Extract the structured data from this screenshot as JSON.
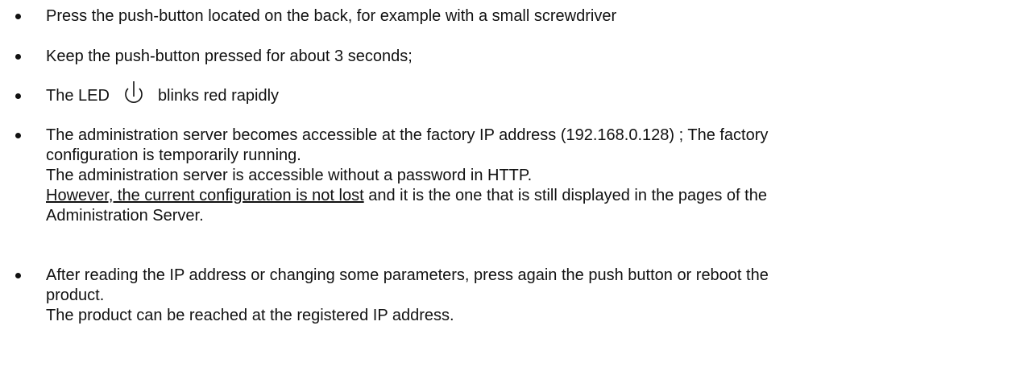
{
  "bullets": [
    {
      "text": "Press the push-button located on the back, for example with a small screwdriver"
    },
    {
      "text": "Keep the push-button pressed for about 3 seconds;"
    },
    {
      "before_icon": "The LED",
      "icon": "power-led-icon",
      "after_icon": "blinks red rapidly"
    },
    {
      "line1": "The administration server becomes accessible at the factory IP address (192.168.0.128) ; The factory",
      "line2": "configuration is temporarily running.",
      "line3": "The administration server is accessible without a password in HTTP.",
      "line4_underlined": "However, the current configuration is not lost",
      "line4_rest": " and it is the one that is still displayed in the pages of the",
      "line5": "Administration Server."
    },
    {
      "line1": "After reading the IP address or changing some parameters, press again the push button or reboot the",
      "line2": "product.",
      "line3": "The product can be reached at the registered IP address."
    }
  ]
}
